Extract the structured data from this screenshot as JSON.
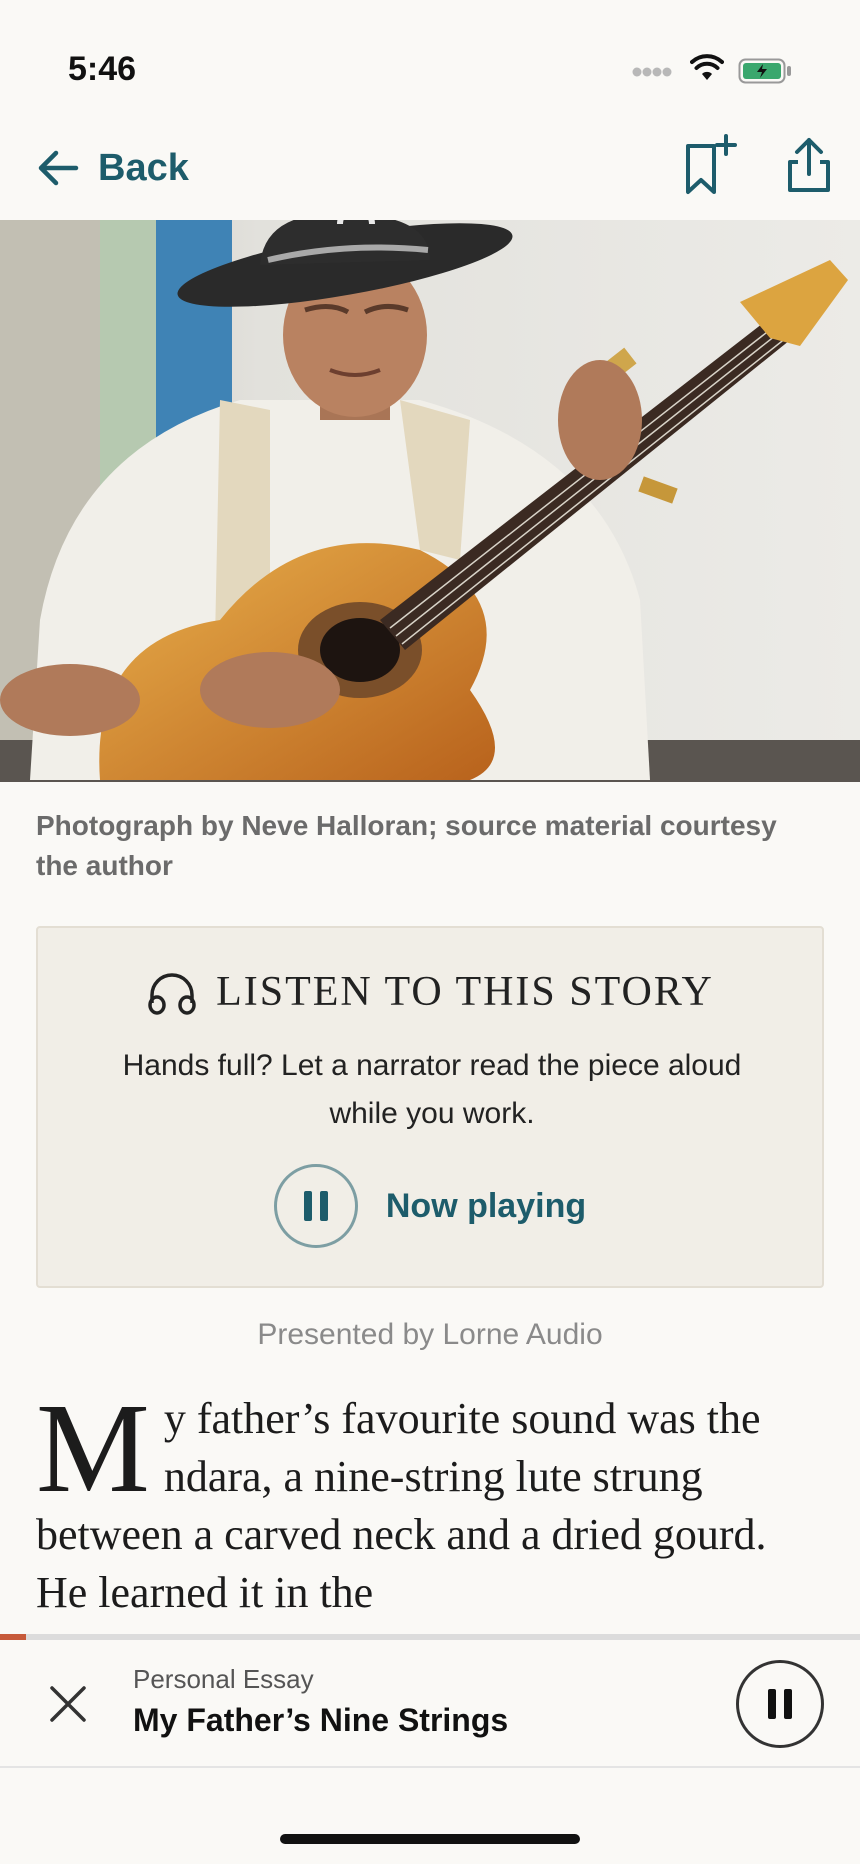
{
  "status_bar": {
    "time": "5:46"
  },
  "nav": {
    "back_label": "Back",
    "icons": [
      "back-arrow-icon",
      "bookmark-add-icon",
      "share-icon"
    ]
  },
  "hero": {
    "caption": "Photograph by Neve Halloran; source material courtesy the author"
  },
  "listen": {
    "title": "LISTEN TO THIS STORY",
    "description": "Hands full? Let a narrator read the piece aloud while you work.",
    "play_label": "Now playing",
    "presented_by": "Presented by Lorne Audio"
  },
  "article": {
    "drop_cap": "M",
    "text": "y father’s favourite sound was the ndara, a nine-string lute strung between a carved neck and a dried gourd. He learned it in the"
  },
  "progress": {
    "fraction": 0.03
  },
  "mini_player": {
    "category": "Personal Essay",
    "title": "My Father’s Nine Strings"
  },
  "colors": {
    "accent": "#1d5c6b",
    "progress": "#c75a3a",
    "box_bg": "#f1eee7",
    "page_bg": "#faf9f6"
  }
}
